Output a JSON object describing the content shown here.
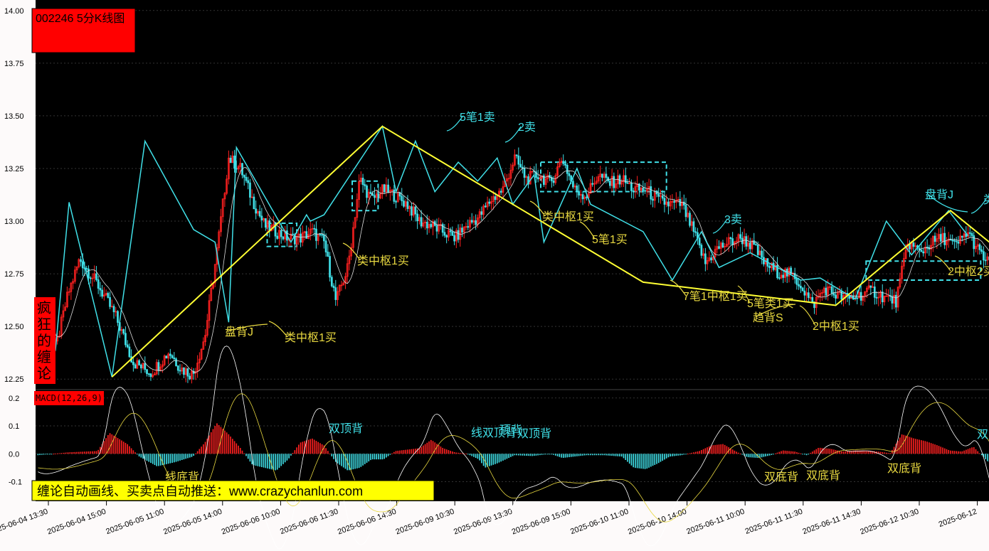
{
  "title": "002246 5分K线图",
  "side_badge": "疯狂的缠论",
  "banner": "缠论自动画线、买卖点自动推送：www.crazychanlun.com",
  "colors": {
    "bg": "#000000",
    "axis_bg": "#fdfafa",
    "up": "#ff2020",
    "down": "#40e0e8",
    "bi": "#40e0e8",
    "segment": "#ffff33",
    "pivot": "#40e0e8",
    "label_cyan": "#40e0e8",
    "label_yellow": "#e8d840",
    "badge": "#ff0000",
    "banner_bg": "#ffff00"
  },
  "chart_data": [
    {
      "type": "candlestick",
      "title": "002246 5分K线图",
      "ylim": [
        12.2,
        14.05
      ],
      "y_ticks": [
        12.25,
        12.5,
        12.75,
        13.0,
        13.25,
        13.5,
        13.75,
        14.0
      ],
      "y_tick_labels": [
        "12.25",
        "12.50",
        "12.75",
        "13.00",
        "13.25",
        "13.50",
        "13.75",
        "14.00"
      ],
      "x_tick_labels": [
        "2025-06-04 13:30",
        "2025-06-04 15:00",
        "2025-06-05 11:00",
        "2025-06-05 14:00",
        "2025-06-06 10:00",
        "2025-06-06 11:30",
        "2025-06-06 14:30",
        "2025-06-09 10:30",
        "2025-06-09 13:30",
        "2025-06-09 15:00",
        "2025-06-10 11:00",
        "2025-06-10 14:00",
        "2025-06-11 10:00",
        "2025-06-11 11:30",
        "2025-06-11 14:30",
        "2025-06-12 10:30",
        "2025-06-12"
      ],
      "bar_count": 320,
      "close_anchors": [
        [
          0,
          12.52
        ],
        [
          6,
          12.4
        ],
        [
          10,
          12.65
        ],
        [
          14,
          12.82
        ],
        [
          20,
          12.7
        ],
        [
          26,
          12.55
        ],
        [
          32,
          12.33
        ],
        [
          38,
          12.28
        ],
        [
          44,
          12.38
        ],
        [
          48,
          12.3
        ],
        [
          52,
          12.27
        ],
        [
          56,
          12.45
        ],
        [
          60,
          12.85
        ],
        [
          64,
          13.3
        ],
        [
          68,
          13.25
        ],
        [
          72,
          13.1
        ],
        [
          76,
          12.98
        ],
        [
          80,
          12.95
        ],
        [
          84,
          12.92
        ],
        [
          88,
          12.92
        ],
        [
          92,
          12.95
        ],
        [
          96,
          12.9
        ],
        [
          100,
          12.62
        ],
        [
          104,
          12.78
        ],
        [
          108,
          13.2
        ],
        [
          112,
          13.1
        ],
        [
          116,
          13.15
        ],
        [
          120,
          13.12
        ],
        [
          124,
          13.08
        ],
        [
          128,
          13.0
        ],
        [
          132,
          12.98
        ],
        [
          136,
          12.95
        ],
        [
          140,
          12.92
        ],
        [
          144,
          12.98
        ],
        [
          148,
          13.02
        ],
        [
          152,
          13.1
        ],
        [
          156,
          13.15
        ],
        [
          160,
          13.3
        ],
        [
          164,
          13.2
        ],
        [
          168,
          13.22
        ],
        [
          172,
          13.18
        ],
        [
          176,
          13.3
        ],
        [
          180,
          13.15
        ],
        [
          184,
          13.12
        ],
        [
          188,
          13.22
        ],
        [
          192,
          13.18
        ],
        [
          196,
          13.2
        ],
        [
          200,
          13.15
        ],
        [
          204,
          13.15
        ],
        [
          208,
          13.1
        ],
        [
          212,
          13.08
        ],
        [
          216,
          13.08
        ],
        [
          220,
          12.95
        ],
        [
          224,
          12.8
        ],
        [
          228,
          12.87
        ],
        [
          232,
          12.9
        ],
        [
          236,
          12.92
        ],
        [
          240,
          12.88
        ],
        [
          244,
          12.8
        ],
        [
          248,
          12.76
        ],
        [
          252,
          12.75
        ],
        [
          256,
          12.7
        ],
        [
          260,
          12.6
        ],
        [
          264,
          12.68
        ],
        [
          268,
          12.65
        ],
        [
          272,
          12.63
        ],
        [
          276,
          12.65
        ],
        [
          280,
          12.67
        ],
        [
          284,
          12.64
        ],
        [
          288,
          12.62
        ],
        [
          292,
          12.9
        ],
        [
          296,
          12.85
        ],
        [
          300,
          12.9
        ],
        [
          304,
          12.92
        ],
        [
          308,
          12.88
        ],
        [
          312,
          12.95
        ],
        [
          316,
          12.85
        ],
        [
          319,
          12.8
        ]
      ],
      "bi_points": [
        [
          0,
          12.52
        ],
        [
          9,
          12.39
        ],
        [
          16,
          13.09
        ],
        [
          38,
          12.26
        ],
        [
          55,
          13.38
        ],
        [
          80,
          12.96
        ],
        [
          91,
          12.9
        ],
        [
          98,
          12.52
        ],
        [
          102,
          13.35
        ],
        [
          130,
          12.9
        ],
        [
          138,
          13.03
        ],
        [
          140,
          13.0
        ],
        [
          147,
          13.03
        ],
        [
          177,
          13.45
        ],
        [
          184,
          13.14
        ],
        [
          194,
          13.38
        ],
        [
          204,
          13.14
        ],
        [
          216,
          13.28
        ],
        [
          226,
          13.19
        ],
        [
          236,
          13.3
        ],
        [
          244,
          13.08
        ],
        [
          255,
          13.22
        ],
        [
          260,
          12.9
        ],
        [
          277,
          13.25
        ],
        [
          284,
          13.08
        ],
        [
          311,
          12.95
        ],
        [
          326,
          12.72
        ],
        [
          341,
          12.95
        ],
        [
          350,
          12.78
        ],
        [
          366,
          12.85
        ],
        [
          392,
          12.72
        ],
        [
          402,
          12.73
        ],
        [
          420,
          12.63
        ],
        [
          436,
          13.0
        ],
        [
          449,
          12.84
        ],
        [
          468,
          13.05
        ],
        [
          478,
          12.93
        ]
      ],
      "segment_points": [
        [
          38,
          12.26
        ],
        [
          177,
          13.45
        ],
        [
          311,
          12.71
        ],
        [
          410,
          12.6
        ],
        [
          441,
          12.84
        ],
        [
          469,
          13.05
        ],
        [
          489,
          12.9
        ]
      ],
      "pivots": [
        [
          62,
          12.88,
          70,
          12.99
        ],
        [
          85,
          13.05,
          92,
          13.19
        ],
        [
          136,
          13.14,
          170,
          13.28
        ],
        [
          224,
          12.72,
          255,
          12.81
        ]
      ],
      "annotations": [
        {
          "text": "5笔1卖",
          "color": "cyan"
        },
        {
          "text": "2卖",
          "color": "cyan"
        },
        {
          "text": "类中枢1买",
          "color": "yellow"
        },
        {
          "text": "5笔1买",
          "color": "yellow"
        },
        {
          "text": "类中枢1买",
          "color": "yellow"
        },
        {
          "text": "盘背J",
          "color": "yellow"
        },
        {
          "text": "类中枢1买",
          "color": "yellow"
        },
        {
          "text": "3卖",
          "color": "cyan"
        },
        {
          "text": "7笔1中枢1买",
          "color": "yellow"
        },
        {
          "text": "5笔类1买",
          "color": "yellow"
        },
        {
          "text": "趋背S",
          "color": "yellow"
        },
        {
          "text": "2中枢1买",
          "color": "yellow"
        },
        {
          "text": "盘背J",
          "color": "cyan"
        },
        {
          "text": "类",
          "color": "cyan"
        },
        {
          "text": "2中枢2买",
          "color": "yellow"
        }
      ]
    },
    {
      "type": "bar",
      "title": "MACD(12,26,9)",
      "ylim": [
        -0.17,
        0.23
      ],
      "y_ticks": [
        -0.1,
        0.0,
        0.1,
        0.2
      ],
      "y_tick_labels": [
        "-0.1",
        "0.0",
        "0.1",
        "0.2"
      ],
      "macd_anchors": [
        [
          0,
          -0.005
        ],
        [
          10,
          0.005
        ],
        [
          20,
          0.01
        ],
        [
          24,
          0.075
        ],
        [
          30,
          0.035
        ],
        [
          34,
          -0.01
        ],
        [
          40,
          -0.045
        ],
        [
          46,
          -0.03
        ],
        [
          52,
          -0.01
        ],
        [
          56,
          0.04
        ],
        [
          60,
          0.11
        ],
        [
          64,
          0.07
        ],
        [
          68,
          0.02
        ],
        [
          72,
          -0.04
        ],
        [
          76,
          -0.05
        ],
        [
          80,
          -0.06
        ],
        [
          84,
          -0.02
        ],
        [
          88,
          0.04
        ],
        [
          92,
          0.055
        ],
        [
          96,
          0.03
        ],
        [
          100,
          -0.03
        ],
        [
          104,
          -0.06
        ],
        [
          108,
          -0.05
        ],
        [
          112,
          -0.02
        ],
        [
          116,
          -0.02
        ],
        [
          120,
          0.01
        ],
        [
          124,
          0.015
        ],
        [
          128,
          0.02
        ],
        [
          132,
          0.05
        ],
        [
          136,
          0.02
        ],
        [
          140,
          0.005
        ],
        [
          144,
          0.0
        ],
        [
          148,
          -0.02
        ],
        [
          150,
          -0.05
        ],
        [
          154,
          -0.035
        ],
        [
          160,
          -0.005
        ],
        [
          166,
          -0.008
        ],
        [
          172,
          0.0
        ],
        [
          176,
          -0.015
        ],
        [
          180,
          -0.01
        ],
        [
          184,
          -0.005
        ],
        [
          190,
          -0.005
        ],
        [
          196,
          -0.01
        ],
        [
          200,
          -0.05
        ],
        [
          204,
          -0.055
        ],
        [
          208,
          -0.035
        ],
        [
          212,
          -0.01
        ],
        [
          216,
          -0.005
        ],
        [
          222,
          0.01
        ],
        [
          226,
          0.03
        ],
        [
          230,
          0.035
        ],
        [
          234,
          0.01
        ],
        [
          238,
          -0.012
        ],
        [
          242,
          -0.015
        ],
        [
          246,
          -0.005
        ],
        [
          250,
          0.012
        ],
        [
          254,
          0.008
        ],
        [
          258,
          -0.005
        ],
        [
          262,
          0.022
        ],
        [
          266,
          0.018
        ],
        [
          270,
          0.008
        ],
        [
          274,
          0.012
        ],
        [
          278,
          0.012
        ],
        [
          282,
          0.008
        ],
        [
          286,
          0.002
        ],
        [
          290,
          0.07
        ],
        [
          294,
          0.055
        ],
        [
          298,
          0.045
        ],
        [
          302,
          0.03
        ],
        [
          306,
          0.012
        ],
        [
          310,
          0.008
        ],
        [
          314,
          0.025
        ],
        [
          319,
          -0.03
        ]
      ],
      "labels": [
        {
          "text": "双顶背",
          "color": "cyan"
        },
        {
          "text": "线双顶背",
          "color": "cyan"
        },
        {
          "text": "顶背",
          "color": "cyan"
        },
        {
          "text": "双顶背",
          "color": "cyan"
        },
        {
          "text": "双底背",
          "color": "yellow"
        },
        {
          "text": "双底背",
          "color": "yellow"
        },
        {
          "text": "双底背",
          "color": "yellow"
        },
        {
          "text": "线底背",
          "color": "yellow"
        },
        {
          "text": "底背",
          "color": "yellow"
        },
        {
          "text": "双",
          "color": "cyan"
        }
      ]
    }
  ]
}
